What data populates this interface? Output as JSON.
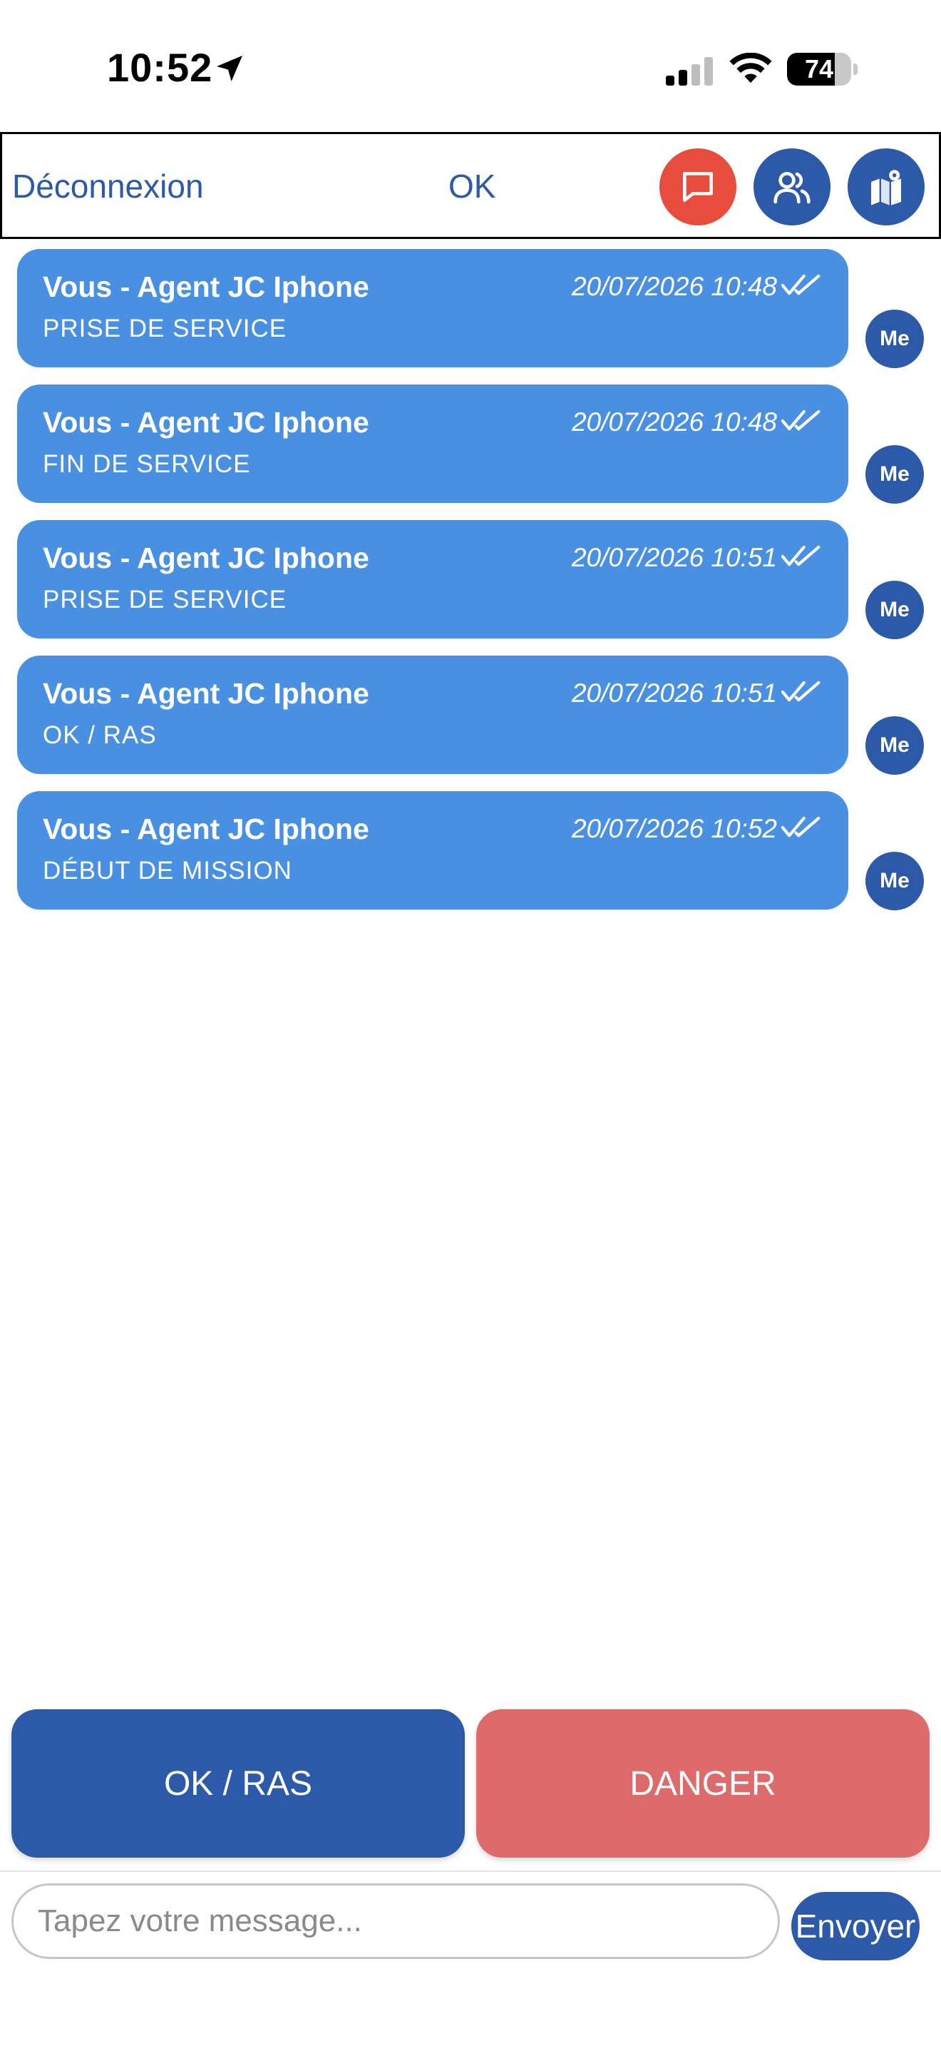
{
  "status_bar": {
    "time": "10:52",
    "battery_level": "74",
    "battery_fraction": 0.74
  },
  "header": {
    "logout_label": "Déconnexion",
    "status_label": "OK",
    "icons": [
      "chat-icon",
      "users-icon",
      "map-icon"
    ],
    "colors": {
      "chat_button": "#e84c3d",
      "primary": "#2c5aa8"
    }
  },
  "messages": [
    {
      "sender": "Vous - Agent JC Iphone",
      "time": "20/07/2026 10:48",
      "text": "PRISE DE SERVICE",
      "avatar": "Me"
    },
    {
      "sender": "Vous - Agent JC Iphone",
      "time": "20/07/2026 10:48",
      "text": "FIN DE SERVICE",
      "avatar": "Me"
    },
    {
      "sender": "Vous - Agent JC Iphone",
      "time": "20/07/2026 10:51",
      "text": "PRISE DE SERVICE",
      "avatar": "Me"
    },
    {
      "sender": "Vous - Agent JC Iphone",
      "time": "20/07/2026 10:51",
      "text": "OK / RAS",
      "avatar": "Me"
    },
    {
      "sender": "Vous - Agent JC Iphone",
      "time": "20/07/2026 10:52",
      "text": "DÉBUT DE MISSION",
      "avatar": "Me"
    }
  ],
  "quick_actions": {
    "ok_label": "OK / RAS",
    "danger_label": "DANGER",
    "colors": {
      "ok": "#2c5aa8",
      "danger": "#dd6b6b"
    }
  },
  "composer": {
    "placeholder": "Tapez votre message...",
    "value": "",
    "send_label": "Envoyer"
  },
  "bubble_color": "#4a90e2"
}
